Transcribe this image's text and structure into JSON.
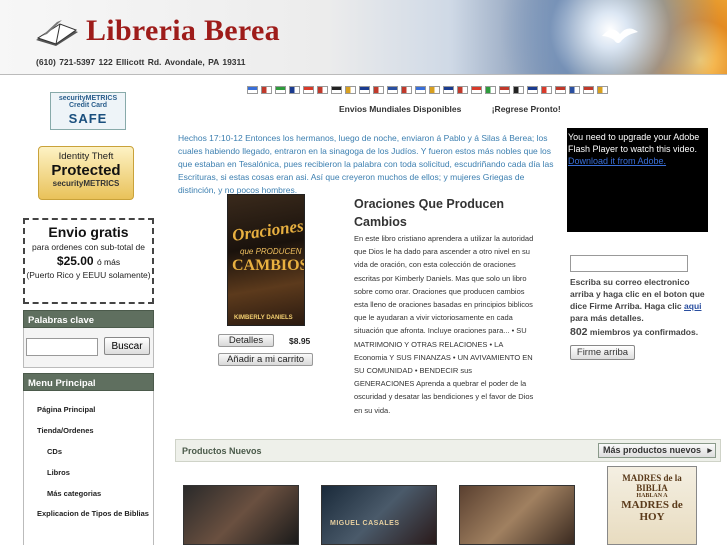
{
  "header": {
    "logo_text": "Libreria Berea",
    "contact_info": "(610) 721-5397   122 Ellicott Rd. Avondale, PA 19311"
  },
  "badges": {
    "metrics_line": "securityMETRICS  Credit Card",
    "metrics_safe": "SAFE",
    "theft_line1": "Identity Theft",
    "theft_line2": "Protected",
    "theft_line3": "securityMETRICS"
  },
  "shipping": {
    "title": "Envio gratis",
    "subtitle": "para ordenes con sub-total de",
    "amount": "$25.00",
    "amount_suffix": "ó más",
    "note": "(Puerto Rico y EEUU solamente)"
  },
  "keywords": {
    "heading": "Palabras clave",
    "search_value": "",
    "search_button": "Buscar"
  },
  "menu": {
    "heading": "Menu Principal",
    "items": [
      {
        "label": "Página Principal",
        "level": 1
      },
      {
        "label": "Tienda/Ordenes",
        "level": 1
      },
      {
        "label": "CDs",
        "level": 2
      },
      {
        "label": "Libros",
        "level": 2
      },
      {
        "label": "Más categorias",
        "level": 2
      },
      {
        "label": "Explicacion de Tipos de Biblias",
        "level": 1
      }
    ]
  },
  "flags": [
    "#3a6fd8",
    "#c0392b",
    "#2e9b3c",
    "#1a3b8f",
    "#d83a2a",
    "#c0392b",
    "#222",
    "#d8a020",
    "#1a3b8f",
    "#c0392b",
    "#2a4fa0",
    "#c0392b",
    "#3a6fd8",
    "#d8a020",
    "#1a3b8f",
    "#c0392b",
    "#d83a2a",
    "#2e9b3c",
    "#c0392b",
    "#222",
    "#1a3b8f",
    "#d83a2a",
    "#c0392b",
    "#2a4fa0",
    "#c0392b",
    "#d8a020"
  ],
  "topnav": {
    "shipping_link": "Envios Mundiales Disponibles",
    "return_link": "¡Regrese Pronto!"
  },
  "verse": "Hechos 17:10-12 Entonces los hermanos, luego de noche, enviaron á Pablo y á Silas á Berea; los cuales habiendo llegado, entraron en la sinagoga de los Judíos. Y fueron estos más nobles que los que estaban en Tesalónica, pues recibieron la palabra con toda solicitud, escudriñando cada día las Escrituras, si estas cosas eran asi. Así que creyeron muchos de ellos; y mujeres Griegas de distinción, y no pocos hombres.",
  "product": {
    "cover_title_1": "Oraciones",
    "cover_title_2": "que PRODUCEN",
    "cover_title_3": "CAMBIOS",
    "cover_author": "KIMBERLY DANIELS",
    "details_button": "Detalles",
    "price": "$8.95",
    "add_button": "Añadir a mi carrito",
    "title": "Oraciones Que Producen Cambios",
    "description": "En este libro cristiano aprendera a utilizar la autoridad que Dios le ha dado para ascender a otro nivel en su vida de oración, con esta colección de oraciones escritas por Kimberly Daniels. Mas que solo un libro sobre como orar. Oraciones que producen cambios esta lleno de oraciones basadas en principios biblicos que le ayudaran a vivir victoriosamente en cada situación que afronta. Incluye oraciones para... • SU MATRIMONIO Y OTRAS RELACIONES • LA Economia Y SUS FINANZAS • UN AVIVAMIENTO EN SU COMUNIDAD • BENDECIR sus GENERACIONES Aprenda a quebrar el poder de la oscuridad y desatar las bendiciones y el favor de Dios en su vida."
  },
  "flash": {
    "message": "You need to upgrade your Adobe Flash Player to watch this video.",
    "link": "Download it from Adobe."
  },
  "newsletter": {
    "email_value": "",
    "text_before": "Escriba su correo electronico arriba y haga clic en el boton que dice Firme Arriba. Haga clic",
    "link": "aqui",
    "text_after": "para más detalles.",
    "count": "802",
    "count_suffix": "miembros ya confirmados.",
    "button": "Firme arriba"
  },
  "new_products": {
    "heading": "Productos Nuevos",
    "more_button": "Más productos nuevos",
    "thumb3_author": "MIGUEL CASALES",
    "thumb4_line1": "MADRES de la BIBLIA",
    "thumb4_line2": "HABLAN A",
    "thumb4_line3": "MADRES de HOY"
  }
}
